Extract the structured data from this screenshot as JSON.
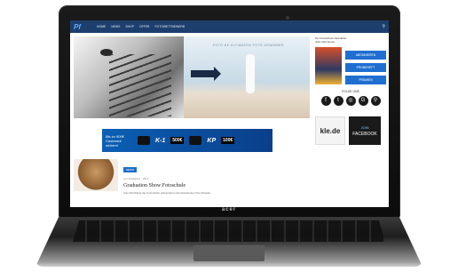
{
  "site": {
    "logo": "Pf",
    "nav": [
      "HOME",
      "NEWS",
      "SHOP",
      "OFFER",
      "FOTOWETTBEWERB"
    ],
    "search_icon": "search-icon"
  },
  "hero": {
    "caption": "FOTO DE ULTIMATEN FOTO GEWINNER"
  },
  "banner": {
    "text": "Bis zu 500€ Cashback sichern!",
    "model1": "K-1",
    "price1": "500€",
    "model2": "KP",
    "price2": "100€"
  },
  "article": {
    "tag": "NEWS",
    "meta": "von Redaktion · 2017",
    "title": "Graduation Show Fotoschule",
    "excerpt": "Zum Abschluss der Fotoschule präsentieren die Absolventen ihre Arbeiten."
  },
  "sidebar": {
    "heading": "Der Fotoschule-Newsletter",
    "sub": "Jetzt abonnieren",
    "buttons": [
      "ABONNIEREN",
      "PROBEHEFT",
      "PRÄMIEN"
    ],
    "follow": "FOLGE UNS",
    "socials": [
      "f",
      "t",
      "◎",
      "G",
      "⚲"
    ],
    "ad1": "kle.de",
    "ad2_title": "JOIN",
    "ad2_text": "FACEBOOK"
  },
  "laptop": {
    "brand": "acer"
  }
}
